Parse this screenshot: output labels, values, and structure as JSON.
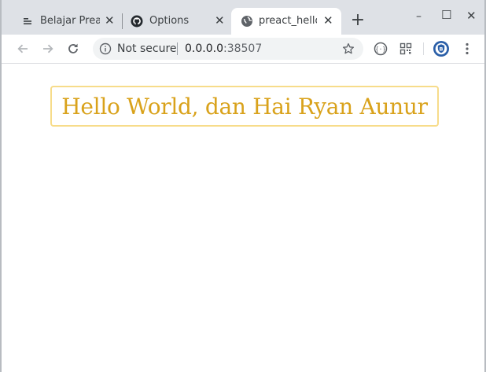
{
  "tabs": [
    {
      "title": "Belajar Preac",
      "icon": "document-lines-icon",
      "active": false
    },
    {
      "title": "Options",
      "icon": "github-icon",
      "active": false
    },
    {
      "title": "preact_hello",
      "icon": "globe-icon",
      "active": true
    }
  ],
  "tab_close_glyph": "✕",
  "new_tab_glyph": "+",
  "window_controls": {
    "minimize": "–",
    "maximize": "☐",
    "close": "✕"
  },
  "address_bar": {
    "security_label": "Not secure",
    "url_host": "0.0.0.0",
    "url_port": ":38507"
  },
  "page": {
    "greeting": "Hello World, dan Hai Ryan Aunur"
  },
  "colors": {
    "greeting_text": "#d9a21b",
    "greeting_border": "#f7dc8a",
    "tabstrip_bg": "#dee1e6",
    "extension_shield": "#2b5fa8"
  }
}
